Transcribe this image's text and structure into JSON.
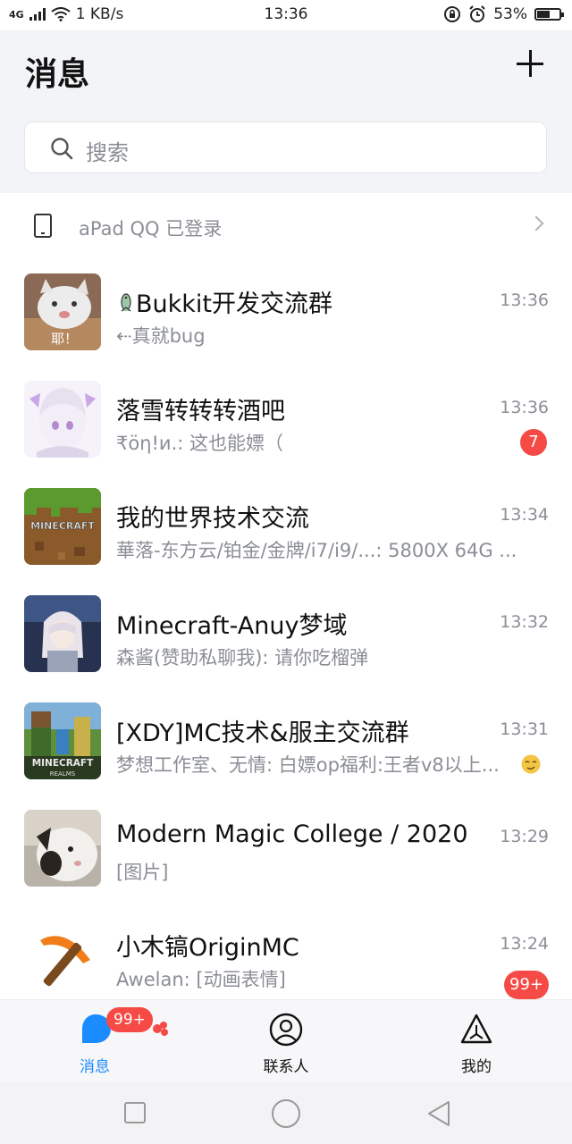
{
  "status_bar": {
    "signal": "4G",
    "speed": "1 KB/s",
    "time": "13:36",
    "battery": "53%",
    "battery_level": 0.53
  },
  "header": {
    "title": "消息",
    "add_icon": "plus-icon"
  },
  "search": {
    "placeholder": "搜索"
  },
  "device_notice": {
    "text": "aPad QQ 已登录"
  },
  "chats": [
    {
      "name": "Bukkit开发交流群",
      "preview": "⇠真就bug",
      "time": "13:36",
      "badge": ""
    },
    {
      "name": "落雪转转转酒吧",
      "preview": "₹öη!и.: 这也能嫖（",
      "time": "13:36",
      "badge": "7"
    },
    {
      "name": "我的世界技术交流",
      "preview": "華落-东方云/铂金/金牌/i7/i9/...: 5800X 64G ...",
      "time": "13:34",
      "badge": ""
    },
    {
      "name": "Minecraft-Anuy梦域",
      "preview": "森酱(赞助私聊我): 请你吃榴弹",
      "time": "13:32",
      "badge": ""
    },
    {
      "name": "[XDY]MC技术&服主交流群",
      "preview": "梦想工作室、无情: 白嫖op福利:王者v8以上...",
      "time": "13:31",
      "badge": ""
    },
    {
      "name": "Modern Magic College / 2020",
      "preview": "[图片]",
      "time": "13:29",
      "badge": ""
    },
    {
      "name": "小木镐OriginMC",
      "preview": "Awelan: [动画表情]",
      "time": "13:24",
      "badge": "99+"
    }
  ],
  "avatar_texts": {
    "cat_caption": "耶！",
    "minecraft": "MINECRAFT",
    "realms": "REALMS"
  },
  "tabs": [
    {
      "label": "消息",
      "icon": "message-bubble-icon",
      "badge": "99+"
    },
    {
      "label": "联系人",
      "icon": "contacts-icon",
      "badge": ""
    },
    {
      "label": "我的",
      "icon": "profile-triangle-icon",
      "badge": ""
    }
  ],
  "colors": {
    "accent": "#1a8cff",
    "badge": "#f54a45",
    "muted_text": "#8b8e96",
    "header_bg": "#f3f4f7"
  }
}
